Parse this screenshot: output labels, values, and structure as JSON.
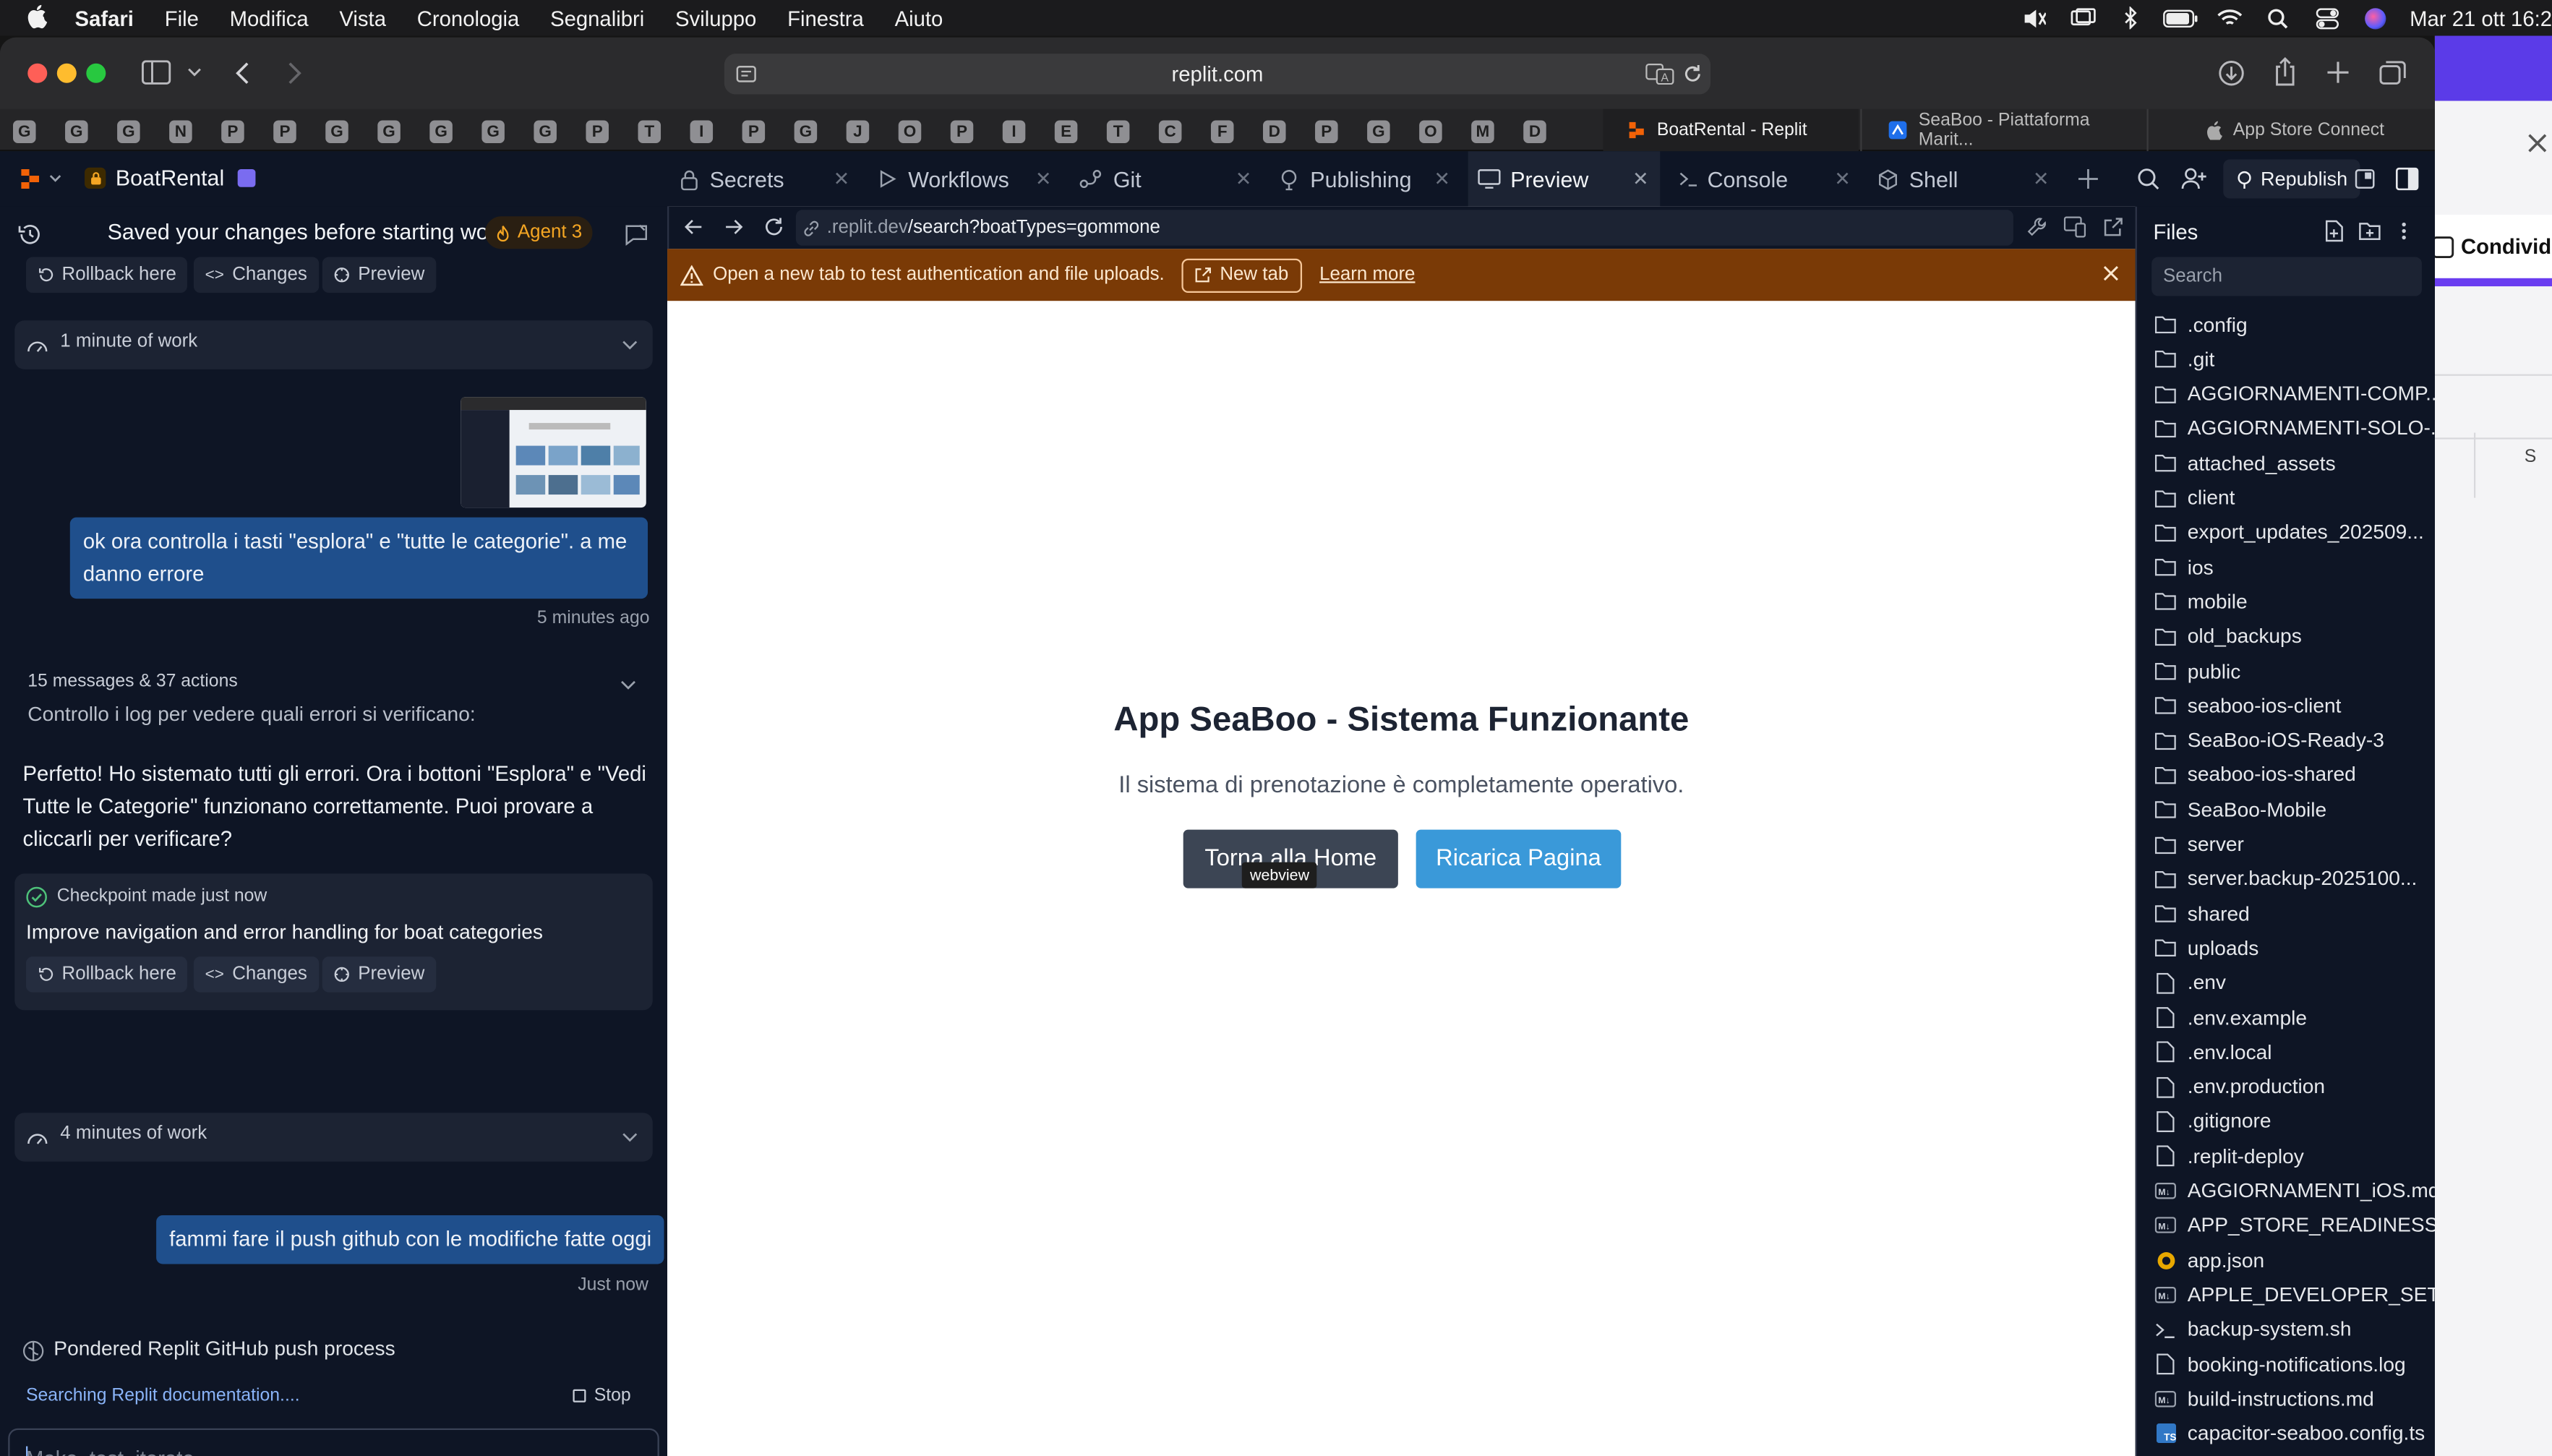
{
  "menubar": {
    "app": "Safari",
    "items": [
      "File",
      "Modifica",
      "Vista",
      "Cronologia",
      "Segnalibri",
      "Sviluppo",
      "Finestra",
      "Aiuto"
    ],
    "clock": "Mar 21 ott 16:2"
  },
  "browser": {
    "url": "replit.com"
  },
  "favorites": [
    "G",
    "G",
    "G",
    "N",
    "P",
    "P",
    "G",
    "G",
    "G",
    "G",
    "G",
    "P",
    "T",
    "I",
    "P",
    "G",
    "J",
    "O",
    "P",
    "I",
    "E",
    "T",
    "C",
    "F",
    "D",
    "P",
    "G",
    "O",
    "M",
    "D"
  ],
  "tabs": {
    "active": "BoatRental - Replit",
    "tab2": "SeaBoo - Piattaforma Marit...",
    "tab3": "App Store Connect"
  },
  "peek": {
    "button": "Condivid",
    "col": "S"
  },
  "replit": {
    "project": "BoatRental",
    "tabs": {
      "secrets": "Secrets",
      "workflows": "Workflows",
      "git": "Git",
      "publishing": "Publishing",
      "preview": "Preview",
      "console": "Console",
      "shell": "Shell"
    },
    "republish": "Republish"
  },
  "agent": {
    "header": "Saved your changes before starting work",
    "badge": "Agent 3",
    "rollback": "Rollback here",
    "changes": "Changes",
    "preview": "Preview",
    "work1": "1 minute of work",
    "msg1": "ok ora controlla i tasti \"esplora\" e \"tutte le categorie\". a me danno errore",
    "msg1_time": "5 minutes ago",
    "summary": "15 messages & 37 actions",
    "log": "Controllo i log per vedere quali errori si verificano:",
    "reply": "Perfetto! Ho sistemato tutti gli errori. Ora i bottoni \"Esplora\" e \"Vedi Tutte le Categorie\" funzionano correttamente. Puoi provare a cliccarli per verificare?",
    "checkpoint": "Checkpoint made just now",
    "checkpoint_title": "Improve navigation and error handling for boat categories",
    "work2": "4 minutes of work",
    "msg2": "fammi fare il push github con le modifiche fatte oggi",
    "msg2_time": "Just now",
    "pondered": "Pondered Replit GitHub push process",
    "searching": "Searching Replit documentation....",
    "stop": "Stop",
    "input_placeholder": "Make, test, iterate..."
  },
  "preview": {
    "url_dim": ".replit.dev",
    "url_path": "/search?boatTypes=gommone",
    "warning": "Open a new tab to test authentication and file uploads.",
    "new_tab": "New tab",
    "learn_more": "Learn more",
    "title": "App SeaBoo - Sistema Funzionante",
    "subtitle": "Il sistema di prenotazione è completamente operativo.",
    "btn_home": "Torna alla Home",
    "btn_reload": "Ricarica Pagina",
    "tooltip": "webview"
  },
  "files": {
    "title": "Files",
    "search_placeholder": "Search",
    "items": [
      {
        "name": ".config",
        "type": "folder"
      },
      {
        "name": ".git",
        "type": "folder"
      },
      {
        "name": "AGGIORNAMENTI-COMP...",
        "type": "folder"
      },
      {
        "name": "AGGIORNAMENTI-SOLO-...",
        "type": "folder"
      },
      {
        "name": "attached_assets",
        "type": "folder"
      },
      {
        "name": "client",
        "type": "folder"
      },
      {
        "name": "export_updates_202509...",
        "type": "folder"
      },
      {
        "name": "ios",
        "type": "folder"
      },
      {
        "name": "mobile",
        "type": "folder"
      },
      {
        "name": "old_backups",
        "type": "folder"
      },
      {
        "name": "public",
        "type": "folder"
      },
      {
        "name": "seaboo-ios-client",
        "type": "folder"
      },
      {
        "name": "SeaBoo-iOS-Ready-3",
        "type": "folder"
      },
      {
        "name": "seaboo-ios-shared",
        "type": "folder"
      },
      {
        "name": "SeaBoo-Mobile",
        "type": "folder"
      },
      {
        "name": "server",
        "type": "folder"
      },
      {
        "name": "server.backup-2025100...",
        "type": "folder"
      },
      {
        "name": "shared",
        "type": "folder"
      },
      {
        "name": "uploads",
        "type": "folder"
      },
      {
        "name": ".env",
        "type": "file"
      },
      {
        "name": ".env.example",
        "type": "file"
      },
      {
        "name": ".env.local",
        "type": "file"
      },
      {
        "name": ".env.production",
        "type": "file"
      },
      {
        "name": ".gitignore",
        "type": "file"
      },
      {
        "name": ".replit-deploy",
        "type": "file"
      },
      {
        "name": "AGGIORNAMENTI_iOS.md",
        "type": "md"
      },
      {
        "name": "APP_STORE_READINESS...",
        "type": "md"
      },
      {
        "name": "app.json",
        "type": "json"
      },
      {
        "name": "APPLE_DEVELOPER_SET...",
        "type": "md"
      },
      {
        "name": "backup-system.sh",
        "type": "sh"
      },
      {
        "name": "booking-notifications.log",
        "type": "file"
      },
      {
        "name": "build-instructions.md",
        "type": "md"
      },
      {
        "name": "capacitor-seaboo.config.ts",
        "type": "ts"
      }
    ]
  },
  "colors": {
    "accent_blue": "#3a99d9",
    "dark_button": "#3c4554",
    "warning_bg": "#7a3a06",
    "bubble": "#1f4f8c",
    "link": "#8ab4f8"
  }
}
